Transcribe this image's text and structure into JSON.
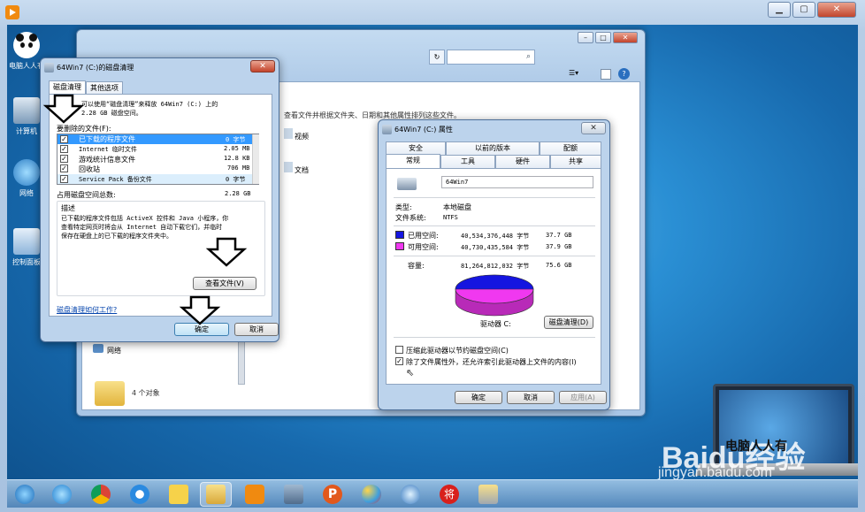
{
  "desktop": {
    "icons": [
      {
        "label": "电脑人人有"
      },
      {
        "label": "计算机"
      },
      {
        "label": "网络"
      },
      {
        "label": "控制面板"
      }
    ]
  },
  "explorer": {
    "search_placeholder": "",
    "status_items": "4 个对象",
    "nav_network": "网络",
    "side_video": "视频",
    "side_doc": "文档",
    "hint_text": "查看文件并根据文件夹、日期和其他属性排列这些文件。"
  },
  "cleanup": {
    "title": "64Win7 (C:)的磁盘清理",
    "tabs": [
      "磁盘清理",
      "其他选项"
    ],
    "intro": "可以使用“磁盘清理”来释放 64Win7 （C:）上的 2.28 GB 磁盘空间。",
    "intro_line1": "可以使用“磁盘清理”来释放 64Win7  (C:) 上的",
    "intro_line2": "2.28 GB 磁盘空间。",
    "files_label": "要删除的文件(F):",
    "files": [
      {
        "name": "已下载的程序文件",
        "size": "0 字节",
        "checked": true,
        "selected": true
      },
      {
        "name": "Internet 临时文件",
        "size": "2.05 MB",
        "checked": true,
        "selected": false
      },
      {
        "name": "游戏统计信息文件",
        "size": "12.8 KB",
        "checked": true,
        "selected": false
      },
      {
        "name": "回收站",
        "size": "706 MB",
        "checked": true,
        "selected": false
      },
      {
        "name": "Service Pack 备份文件",
        "size": "0 字节",
        "checked": true,
        "selected": false
      }
    ],
    "total_label": "占用磁盘空间总数:",
    "total_value": "2.28 GB",
    "desc_title": "描述",
    "desc_text": "已下载的程序文件包括 ActiveX 控件和 Java 小程序，你查看特定网页时将会从 Internet 自动下载它们，并临时保存在硬盘上的已下载的程序文件夹中。",
    "desc_line1": "已下载的程序文件包括 ActiveX 控件和 Java 小程序，你",
    "desc_line2": "查看特定网页时将会从 Internet 自动下载它们，并临时",
    "desc_line3": "保存在硬盘上的已下载的程序文件夹中。",
    "view_files": "查看文件(V)",
    "how_link": "磁盘清理如何工作?",
    "ok": "确定",
    "cancel": "取消"
  },
  "props": {
    "title": "64Win7 (C:) 属性",
    "tabs_row1": [
      "安全",
      "以前的版本",
      "配额"
    ],
    "tabs_row2": [
      "常规",
      "工具",
      "硬件",
      "共享"
    ],
    "drive_name": "64Win7",
    "type_label": "类型:",
    "type_value": "本地磁盘",
    "fs_label": "文件系统:",
    "fs_value": "NTFS",
    "used_label": "已用空间:",
    "used_bytes": "40,534,376,448 字节",
    "used_gb": "37.7 GB",
    "free_label": "可用空间:",
    "free_bytes": "40,730,435,584 字节",
    "free_gb": "37.9 GB",
    "cap_label": "容量:",
    "cap_bytes": "81,264,812,032 字节",
    "cap_gb": "75.6 GB",
    "drive_label": "驱动器 C:",
    "cleanup_btn": "磁盘清理(D)",
    "compress": "压缩此驱动器以节约磁盘空间(C)",
    "compress_checked": false,
    "index": "除了文件属性外，还允许索引此驱动器上文件的内容(I)",
    "index_checked": true,
    "ok": "确定",
    "cancel": "取消",
    "apply": "应用(A)",
    "used_fraction": 0.499,
    "colors": {
      "used": "#1515e0",
      "free": "#f038f0"
    }
  },
  "watermark": {
    "brand": "Baidu经验",
    "url": "jingyan.baidu.com",
    "side": "电脑人人有"
  }
}
